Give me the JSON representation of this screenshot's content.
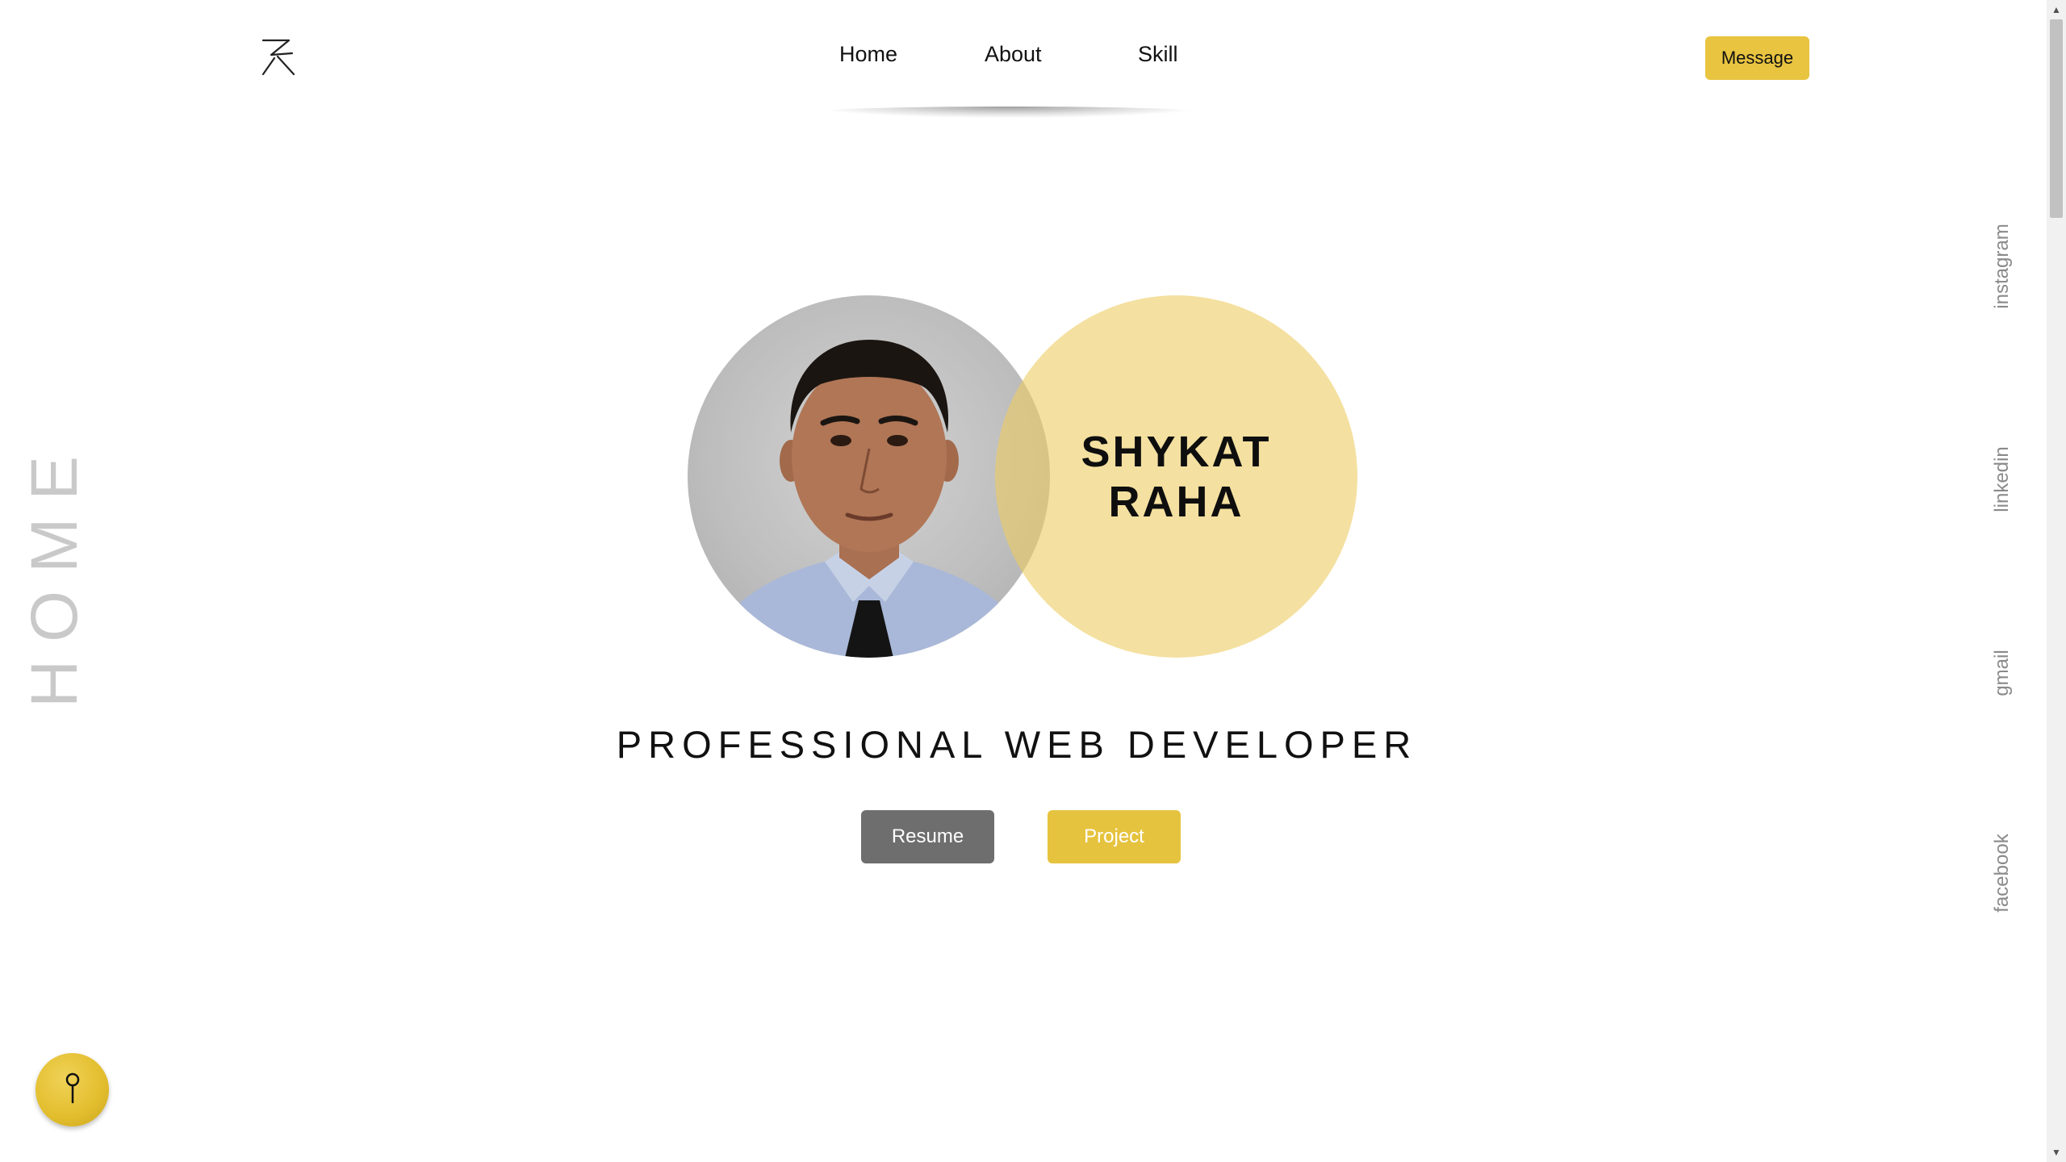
{
  "header": {
    "logo_icon": "signature-logo-icon",
    "nav": [
      "Home",
      "About",
      "Skill"
    ],
    "message_label": "Message"
  },
  "side_label": "HOME",
  "social": {
    "instagram": "instagram",
    "linkedin": "linkedin",
    "gmail": "gmail",
    "facebook": "facebook"
  },
  "hero": {
    "first_name": "SHYKAT",
    "last_name": "RAHA",
    "tagline": "PROFESSIONAL WEB DEVELOPER",
    "resume_label": "Resume",
    "project_label": "Project"
  },
  "fab_icon": "pin-icon",
  "colors": {
    "accent": "#e8c440",
    "accent_circle": "#f2e09e",
    "resume_button": "#6e6e6e",
    "side_label": "#c9c9c9"
  }
}
